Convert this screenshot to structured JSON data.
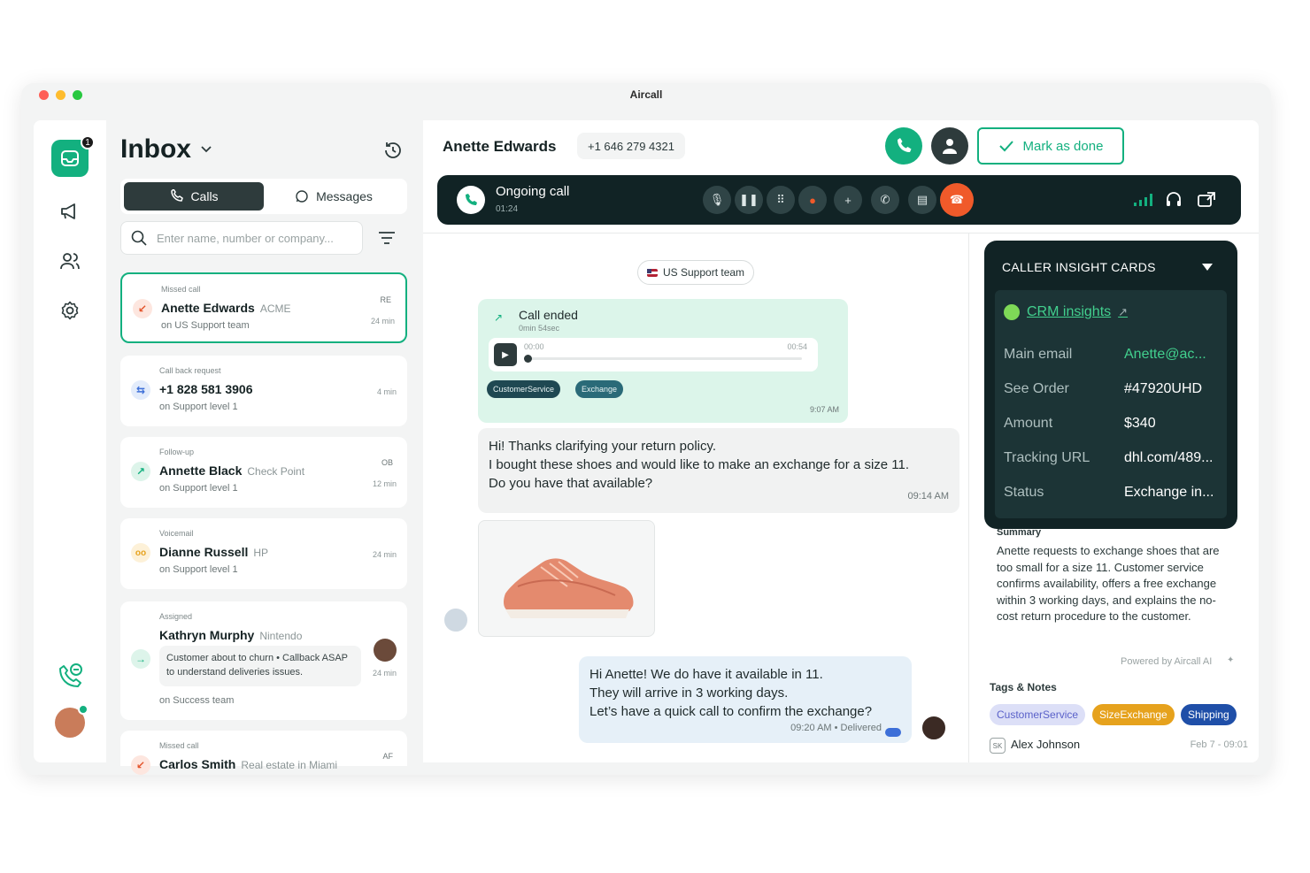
{
  "window": {
    "title": "Aircall"
  },
  "rail": {
    "inbox_badge": "1"
  },
  "inbox": {
    "title": "Inbox",
    "tabs": [
      {
        "label": "Calls"
      },
      {
        "label": "Messages"
      }
    ],
    "search_placeholder": "Enter name, number or company...",
    "items": [
      {
        "type": "Missed call",
        "name": "Anette Edwards",
        "company": "ACME",
        "sub": "on  US Support team",
        "initials": "RE",
        "time": "24 min"
      },
      {
        "type": "Call back request",
        "name": "+1 828 581 3906",
        "company": "",
        "sub": "on  Support level 1",
        "initials": "",
        "time": "4 min"
      },
      {
        "type": "Follow-up",
        "name": "Annette Black",
        "company": "Check Point",
        "sub": "on  Support level 1",
        "initials": "OB",
        "time": "12 min"
      },
      {
        "type": "Voicemail",
        "name": "Dianne Russell",
        "company": "HP",
        "sub": "on  Support level 1",
        "initials": "",
        "time": "24 min"
      },
      {
        "type": "Assigned",
        "name": "Kathryn Murphy",
        "company": "Nintendo",
        "note": "Customer about to churn • Callback ASAP to understand deliveries issues.",
        "sub": "on  Success team",
        "initials": "",
        "time": "24 min"
      },
      {
        "type": "Missed call",
        "name": "Carlos Smith",
        "company": "Real estate in Miami",
        "sub": "",
        "initials": "AF",
        "time": ""
      }
    ]
  },
  "header": {
    "contact_name": "Anette Edwards",
    "phone": "+1 646 279 4321",
    "done_label": "Mark as done"
  },
  "callbar": {
    "status": "Ongoing call",
    "duration": "01:24"
  },
  "chat": {
    "team": "US Support team",
    "call_card": {
      "title": "Call ended",
      "duration": "0min 54sec",
      "start": "00:00",
      "end": "00:54",
      "tags": [
        "CustomerService",
        "Exchange"
      ],
      "time": "9:07 AM"
    },
    "incoming": {
      "line1": "Hi! Thanks clarifying your return policy.",
      "line2": "I bought these shoes and would like to make an exchange for a size 11.",
      "line3": "Do you have that available?",
      "time": "09:14 AM"
    },
    "outgoing": {
      "line1": "Hi Anette! We do have it available in 11.",
      "line2": "They will arrive in 3 working days.",
      "line3": "Let’s have a quick call to confirm the exchange?",
      "status": "09:20 AM • Delivered"
    }
  },
  "insight": {
    "title": "CALLER INSIGHT CARDS",
    "crm_label": "CRM insights",
    "rows": [
      {
        "key": "Main email",
        "value": "Anette@ac..."
      },
      {
        "key": "See Order",
        "value": "#47920UHD"
      },
      {
        "key": "Amount",
        "value": "$340"
      },
      {
        "key": "Tracking URL",
        "value": "dhl.com/489..."
      },
      {
        "key": "Status",
        "value": "Exchange in..."
      }
    ],
    "summary_title": "Summary",
    "summary": "Anette requests to exchange shoes that are too small for a size 11. Customer service confirms availability, offers a free exchange within 3 working days, and explains the no-cost return procedure to the customer.",
    "powered": "Powered by Aircall AI",
    "tags_title": "Tags & Notes",
    "tags": [
      "CustomerService",
      "SizeExchange",
      "Shipping"
    ],
    "note_initials": "SK",
    "note_author": "Alex Johnson",
    "note_date": "Feb 7 - 09:01"
  },
  "colors": {
    "accent": "#13b07f",
    "dark": "#112325",
    "hangup": "#f05a2a"
  }
}
